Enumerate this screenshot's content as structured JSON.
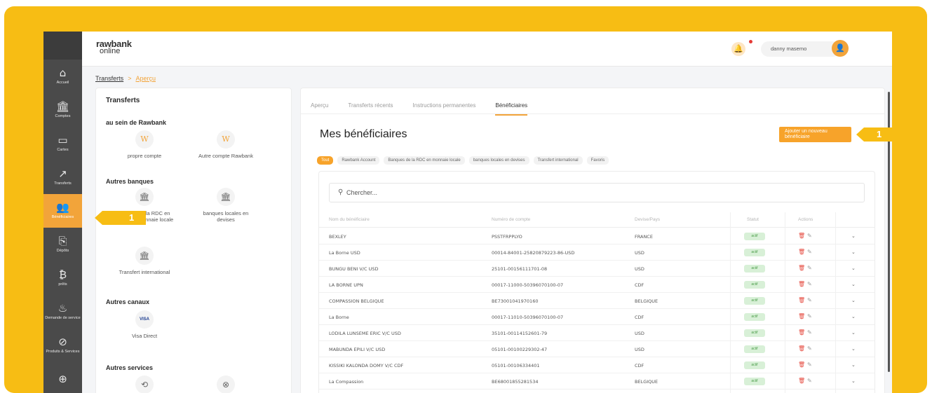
{
  "rail": [
    {
      "icon": "home-icon",
      "glyph": "⌂",
      "label": "Accueil"
    },
    {
      "icon": "bank-icon",
      "glyph": "🏛",
      "label": "Comptes"
    },
    {
      "icon": "card-icon",
      "glyph": "▭",
      "label": "Cartes"
    },
    {
      "icon": "transfer-arrow-icon",
      "glyph": "↗",
      "label": "Transferts"
    },
    {
      "icon": "users-icon",
      "glyph": "👥",
      "label": "Bénéficiaires"
    },
    {
      "icon": "deposit-icon",
      "glyph": "⎘",
      "label": "Dépôts"
    },
    {
      "icon": "loan-icon",
      "glyph": "₿",
      "label": "prêts"
    },
    {
      "icon": "service-icon",
      "glyph": "♨",
      "label": "Demande de service"
    },
    {
      "icon": "products-icon",
      "glyph": "⊘",
      "label": "Produits & Services"
    },
    {
      "icon": "settings-icon",
      "glyph": "⊕",
      "label": ""
    }
  ],
  "header": {
    "logo_line1": "rawbank",
    "logo_line2": "online",
    "username": "danny masemo"
  },
  "breadcrumb": {
    "item1": "Transferts",
    "separator": ">",
    "item2": "Aperçu"
  },
  "left_panel": {
    "title": "Transferts",
    "section1": "au sein de Rawbank",
    "tile_own": "propre compte",
    "tile_other_rawbank": "Autre compte Rawbank",
    "section2": "Autres banques",
    "tile_rdc_local": "e la RDC en\nmonnaie locale",
    "tile_local_currency": "banques locales en\ndevises",
    "tile_international": "Transfert international",
    "section3": "Autres canaux",
    "tile_visa_glyph": "VISA",
    "tile_visa": "Visa Direct",
    "section4": "Autres services"
  },
  "tabs": [
    "Aperçu",
    "Transferts récents",
    "Instructions permanentes",
    "Bénéficiaires"
  ],
  "main": {
    "title": "Mes bénéficiaires",
    "add_button": "Ajouter un nouveau\nbénéficiaire",
    "chips": [
      "Tout",
      "Rawbank Account",
      "Banques de la RDC en monnaie locale",
      "banques locales en devises",
      "Transfert international",
      "Favoris"
    ],
    "search_placeholder": "Chercher...",
    "columns": [
      "Nom du bénéficiaire",
      "Numéro de compte",
      "Devise/Pays",
      "Statut",
      "Actions"
    ],
    "rows": [
      {
        "name": "BEXLEY",
        "account": "PSSTFRPPLYO",
        "country": "FRANCE",
        "status": "actif"
      },
      {
        "name": "La Borne USD",
        "account": "00014-84001-25820879223-86-USD",
        "country": "USD",
        "status": "actif"
      },
      {
        "name": "BUNGU BENI V/C USD",
        "account": "25101-00156111701-08",
        "country": "USD",
        "status": "actif"
      },
      {
        "name": "LA BORNE UPN",
        "account": "00017-11000-50396070100-07",
        "country": "CDF",
        "status": "actif"
      },
      {
        "name": "COMPASSION BELGIQUE",
        "account": "BE73001041970160",
        "country": "BELGIQUE",
        "status": "actif"
      },
      {
        "name": "La Borne",
        "account": "00017-11010-50396070100-07",
        "country": "CDF",
        "status": "actif"
      },
      {
        "name": "LODILA LUNSEME ERIC V/C USD",
        "account": "35101-00114152601-79",
        "country": "USD",
        "status": "actif"
      },
      {
        "name": "MABUNDA EPILI V/C USD",
        "account": "05101-00100229302-47",
        "country": "USD",
        "status": "actif"
      },
      {
        "name": "KISSIKI KALONDA DOMY V/C CDF",
        "account": "05101-00106334401",
        "country": "CDF",
        "status": "actif"
      },
      {
        "name": "La Compassion",
        "account": "BE68001855281534",
        "country": "BELGIQUE",
        "status": "actif"
      }
    ]
  },
  "callouts": {
    "left": "1",
    "right": "1"
  }
}
